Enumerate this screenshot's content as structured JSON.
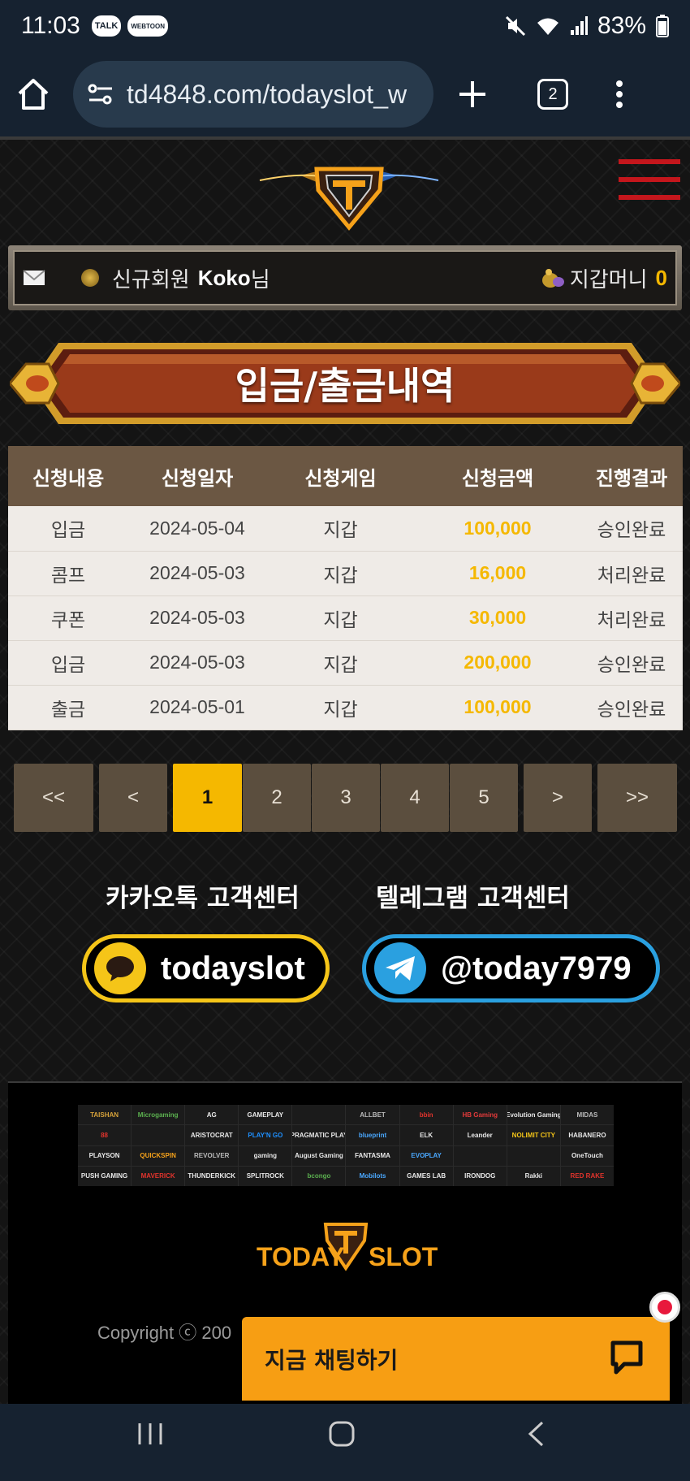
{
  "status_bar": {
    "time": "11:03",
    "app_icons": [
      "TALK",
      "WEBTOON"
    ],
    "battery": "83%"
  },
  "browser": {
    "url": "td4848.com/todayslot_w",
    "tab_count": "2"
  },
  "user_bar": {
    "level": "신규회원",
    "name": "Koko",
    "suffix": "님",
    "wallet_label": "지갑머니",
    "wallet_amount": "0"
  },
  "page_title": "입금/출금내역",
  "table": {
    "headers": [
      "신청내용",
      "신청일자",
      "신청게임",
      "신청금액",
      "진행결과"
    ],
    "rows": [
      {
        "type": "입금",
        "date": "2024-05-04",
        "game": "지갑",
        "amount": "100,000",
        "result": "승인완료"
      },
      {
        "type": "콤프",
        "date": "2024-05-03",
        "game": "지갑",
        "amount": "16,000",
        "result": "처리완료"
      },
      {
        "type": "쿠폰",
        "date": "2024-05-03",
        "game": "지갑",
        "amount": "30,000",
        "result": "처리완료"
      },
      {
        "type": "입금",
        "date": "2024-05-03",
        "game": "지갑",
        "amount": "200,000",
        "result": "승인완료"
      },
      {
        "type": "출금",
        "date": "2024-05-01",
        "game": "지갑",
        "amount": "100,000",
        "result": "승인완료"
      }
    ]
  },
  "pagination": {
    "first": "<<",
    "prev": "<",
    "pages": [
      "1",
      "2",
      "3",
      "4",
      "5"
    ],
    "active_page": "1",
    "next": ">",
    "last": ">>"
  },
  "contact": {
    "kakao_label": "카카오톡 고객센터",
    "kakao_id": "todayslot",
    "telegram_label": "텔레그램 고객센터",
    "telegram_id": "@today7979"
  },
  "footer": {
    "providers": [
      "TAISHAN",
      "Microgaming",
      "AG",
      "GAMEPLAY",
      "",
      "ALLBET",
      "bbin",
      "HB Gaming",
      "Evolution Gaming",
      "MIDAS",
      "88",
      "",
      "ARISTOCRAT",
      "PLAY'N GO",
      "PRAGMATIC PLAY",
      "blueprint",
      "ELK",
      "Leander",
      "NOLIMIT CITY",
      "HABANERO",
      "PLAYSON",
      "QUICKSPIN",
      "REVOLVER",
      "gaming",
      "August Gaming",
      "FANTASMA",
      "EVOPLAY",
      "",
      "",
      "OneTouch",
      "PUSH GAMING",
      "MAVERICK",
      "THUNDERKICK",
      "SPLITROCK",
      "bcongo",
      "Mobilots",
      "GAMES LAB",
      "IRONDOG",
      "Rakki",
      "RED RAKE"
    ],
    "logo_left": "TODAY",
    "logo_right": "SLOT",
    "copyright": "Copyright ⓒ 200"
  },
  "chat": {
    "label": "지금 채팅하기"
  },
  "colors": {
    "accent": "#f5b800",
    "header_bg": "#6b5743",
    "menu_red": "#c4161c",
    "chat_orange": "#f79e13",
    "kakao": "#f5c518",
    "telegram": "#2aa0e0"
  }
}
